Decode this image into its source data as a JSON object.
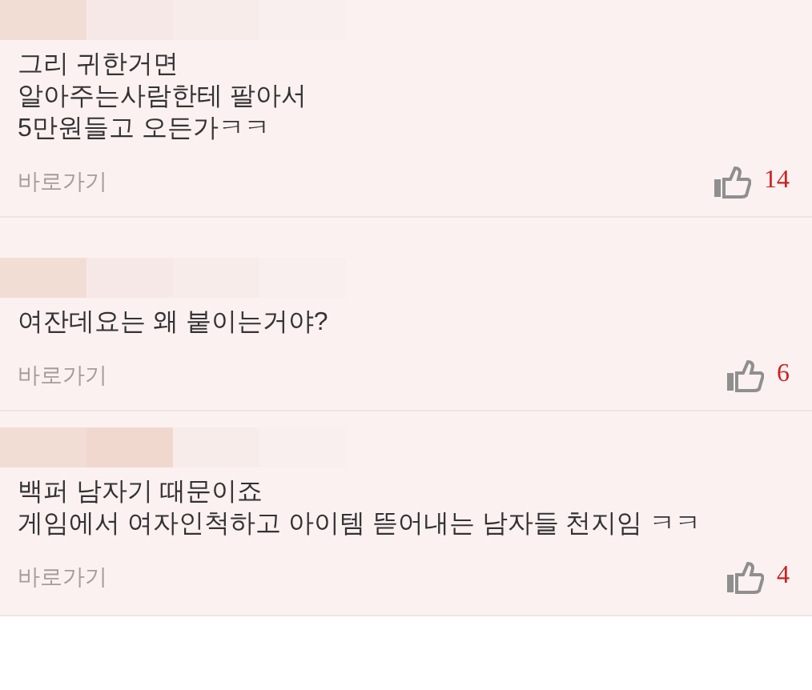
{
  "comments": [
    {
      "lines": [
        "그리 귀한거면",
        "알아주는사람한테 팔아서",
        "5만원들고 오든가ㅋㅋ"
      ],
      "link": "바로가기",
      "likes": "14"
    },
    {
      "lines": [
        "여잔데요는 왜 붙이는거야?"
      ],
      "link": "바로가기",
      "likes": "6"
    },
    {
      "lines": [
        "백퍼 남자기 때문이죠",
        "게임에서 여자인척하고 아이템 뜯어내는 남자들 천지임 ㅋㅋ"
      ],
      "link": "바로가기",
      "likes": "4"
    }
  ]
}
